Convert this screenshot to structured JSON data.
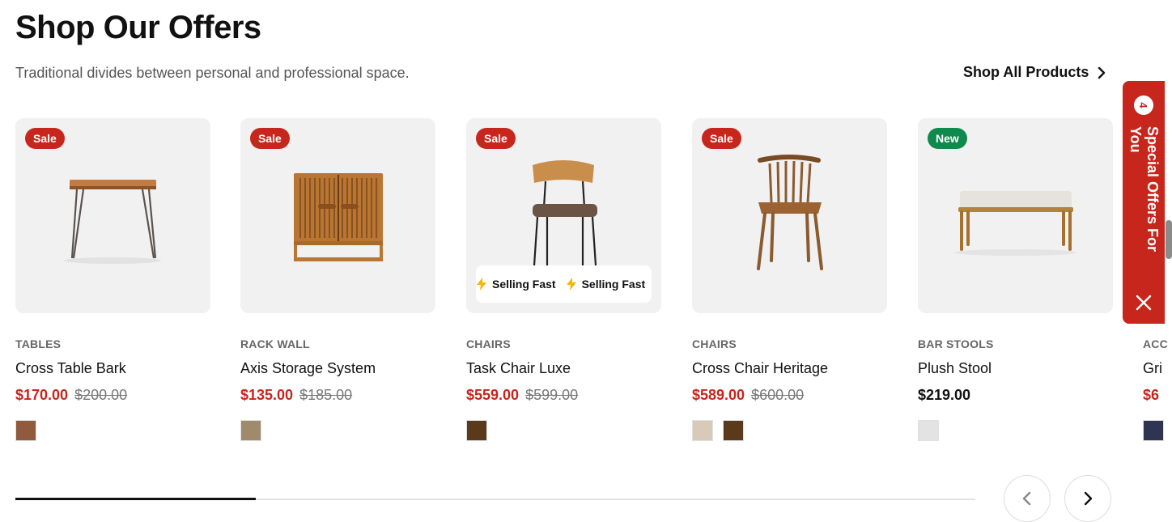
{
  "header": {
    "title": "Shop Our Offers",
    "subtitle": "Traditional divides between personal and professional space.",
    "shop_all_label": "Shop All Products"
  },
  "products": [
    {
      "badge": "Sale",
      "category": "TABLES",
      "name": "Cross Table Bark",
      "price": "$170.00",
      "old_price": "$200.00",
      "swatches": [
        "#8f5a3e"
      ]
    },
    {
      "badge": "Sale",
      "category": "RACK WALL",
      "name": "Axis Storage System",
      "price": "$135.00",
      "old_price": "$185.00",
      "swatches": [
        "#a08a6c"
      ]
    },
    {
      "badge": "Sale",
      "category": "CHAIRS",
      "name": "Task Chair Luxe",
      "price": "$559.00",
      "old_price": "$599.00",
      "swatches": [
        "#5a3a1a"
      ],
      "marquee": [
        "Selling Fast",
        "Selling Fast"
      ]
    },
    {
      "badge": "Sale",
      "category": "CHAIRS",
      "name": "Cross Chair Heritage",
      "price": "$589.00",
      "old_price": "$600.00",
      "swatches": [
        "#d9c9b8",
        "#5a3a1a"
      ]
    },
    {
      "badge": "New",
      "category": "BAR STOOLS",
      "name": "Plush Stool",
      "price": "$219.00",
      "old_price": "",
      "swatches": [
        "#e3e3e3"
      ]
    }
  ],
  "partial_product": {
    "category": "ACC",
    "name": "Gri",
    "price": "$6",
    "swatches": [
      "#2e3553"
    ]
  },
  "side_tab": {
    "count": "4",
    "label": "Special Offers For You"
  },
  "carousel": {
    "progress": 0.25
  },
  "colors": {
    "accent": "#c7261c",
    "new": "#0f8a4d"
  }
}
